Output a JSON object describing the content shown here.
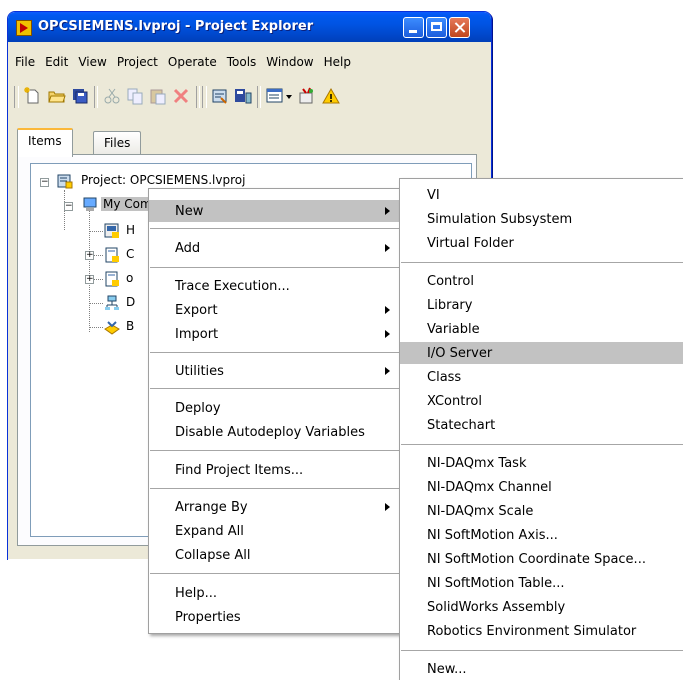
{
  "window": {
    "title": "OPCSIEMENS.lvproj - Project Explorer",
    "menubar": [
      "File",
      "Edit",
      "View",
      "Project",
      "Operate",
      "Tools",
      "Window",
      "Help"
    ],
    "tabs": [
      "Items",
      "Files"
    ],
    "active_tab": "Items"
  },
  "tree": {
    "project": "Project: OPCSIEMENS.lvproj",
    "computer": "My Computer",
    "children_visible": [
      "H",
      "C",
      "o",
      "D",
      "B"
    ]
  },
  "context_menu": {
    "items": [
      {
        "label": "New",
        "submenu": true,
        "highlighted": true
      },
      {
        "label": "Add",
        "submenu": true
      },
      {
        "label": "Trace Execution..."
      },
      {
        "label": "Export",
        "submenu": true
      },
      {
        "label": "Import",
        "submenu": true
      },
      {
        "label": "Utilities",
        "submenu": true
      },
      {
        "label": "Deploy"
      },
      {
        "label": "Disable Autodeploy Variables"
      },
      {
        "label": "Find Project Items..."
      },
      {
        "label": "Arrange By",
        "submenu": true
      },
      {
        "label": "Expand All"
      },
      {
        "label": "Collapse All"
      },
      {
        "label": "Help..."
      },
      {
        "label": "Properties"
      }
    ]
  },
  "new_submenu": {
    "items": [
      {
        "label": "VI"
      },
      {
        "label": "Simulation Subsystem"
      },
      {
        "label": "Virtual Folder"
      },
      {
        "label": "Control"
      },
      {
        "label": "Library"
      },
      {
        "label": "Variable"
      },
      {
        "label": "I/O Server",
        "highlighted": true
      },
      {
        "label": "Class"
      },
      {
        "label": "XControl"
      },
      {
        "label": "Statechart"
      },
      {
        "label": "NI-DAQmx Task"
      },
      {
        "label": "NI-DAQmx Channel"
      },
      {
        "label": "NI-DAQmx Scale"
      },
      {
        "label": "NI SoftMotion Axis..."
      },
      {
        "label": "NI SoftMotion Coordinate Space..."
      },
      {
        "label": "NI SoftMotion Table..."
      },
      {
        "label": "SolidWorks Assembly"
      },
      {
        "label": "Robotics Environment Simulator"
      },
      {
        "label": "New..."
      }
    ]
  },
  "colors": {
    "titlebar": "#0054e3",
    "menu_highlight": "#c2c2c2",
    "window_bg": "#ece9d8"
  }
}
